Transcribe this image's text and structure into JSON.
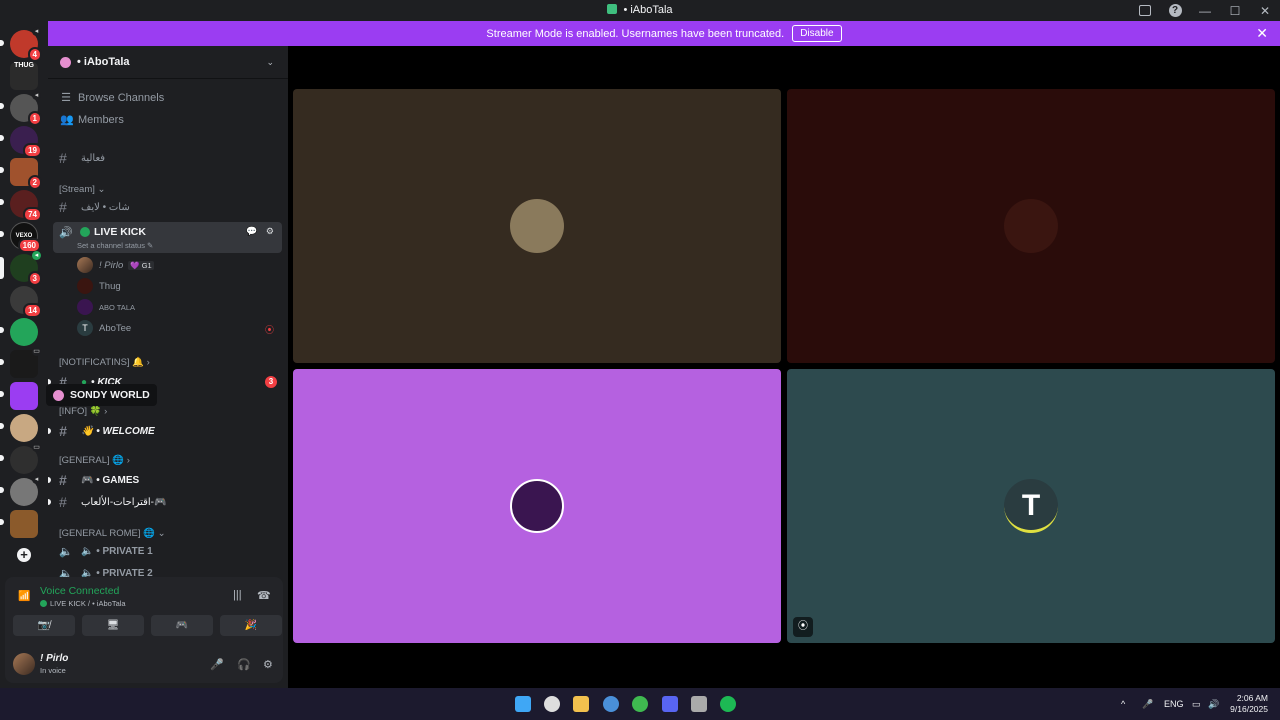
{
  "window": {
    "title": "• iAboTala",
    "inbox_icon": "inbox-icon",
    "help_icon": "help-icon",
    "help_glyph": "?",
    "minimize_glyph": "—",
    "maximize_glyph": "☐",
    "close_glyph": "✕"
  },
  "banner": {
    "text": "Streamer Mode is enabled. Usernames have been truncated.",
    "disable_label": "Disable",
    "close_glyph": "✕"
  },
  "rail": {
    "servers": [
      {
        "badge": "4",
        "color": "#c0392b"
      },
      {
        "label": "THUG",
        "color": "#2b2b2b"
      },
      {
        "badge": "1",
        "color": "#555555"
      },
      {
        "badge": "19",
        "color": "#3a1f4f"
      },
      {
        "badge": "2",
        "color": "#a0522d"
      },
      {
        "badge": "74",
        "color": "#5a1f1f"
      },
      {
        "badge": "160",
        "label": "VEXO",
        "color": "#111111"
      },
      {
        "badge": "3",
        "color": "#1f3f1f"
      },
      {
        "badge": "14",
        "color": "#3a3a3a"
      },
      {
        "color": "#23a55a"
      },
      {
        "color": "#1a1a1a"
      },
      {
        "color": "#9b3df2"
      },
      {
        "color": "#c8a882"
      },
      {
        "color": "#2f2f2f"
      },
      {
        "color": "#777777"
      },
      {
        "color": "#8b5a2b"
      }
    ],
    "add_glyph": "+",
    "tooltip": "SONDY WORLD"
  },
  "sidebar": {
    "guild_name": "• iAboTala",
    "chevron": "⌄",
    "browse_label": "Browse Channels",
    "members_label": "Members",
    "channels": {
      "fa3aliya": "فعالية",
      "stream_cat": "[Stream] ⌄",
      "chat_live": "شات • لايف",
      "live_kick": "LIVE KICK",
      "live_kick_status": "Set a channel status ✎",
      "live_kick_actions": "💬 ⚙",
      "notif_cat": "[NOTIFICATINS] 🔔 ›",
      "kick": "• KICK",
      "kick_mentions": "3",
      "info_cat": "[INFO] 🍀 ›",
      "welcome": "👋 • WELCOME",
      "general_cat": "[GENERAL] 🌐 ›",
      "games": "🎮 • GAMES",
      "suggestions": "اقتراحات-الألعاب-🎮",
      "general_rome_cat": "[GENERAL ROME] 🌐 ⌄",
      "private1": "🔈 • PRIVATE 1",
      "private2": "🔈 • PRIVATE 2"
    },
    "voice_users": [
      {
        "name": "! Pirlo",
        "tag": "💜 G1"
      },
      {
        "name": "Thug"
      },
      {
        "name": "ABO TALA"
      },
      {
        "name": "AboTee",
        "live": "⦿"
      }
    ]
  },
  "voice": {
    "title": "Voice Connected",
    "subtitle": "LIVE KICK / • iAboTala",
    "signal_glyph": "📶",
    "noise_glyph": "|||",
    "disconnect_glyph": "☎",
    "btn_camera": "📷̸",
    "btn_screen": "🖥",
    "btn_activity": "🎮",
    "btn_soundboard": "🎉"
  },
  "user": {
    "name": "! Pirlo",
    "status": "In voice",
    "mic_glyph": "🎤",
    "headset_glyph": "🎧",
    "settings_glyph": "⚙"
  },
  "tiles": [
    {
      "bg": "#352b20",
      "avatar": "#8a7a5c"
    },
    {
      "bg": "#2a0c0a",
      "avatar": "#3a1510"
    },
    {
      "bg": "#b561e0",
      "avatar": "#3a1550"
    },
    {
      "bg": "#2d4a4e",
      "avatar": "#2a3c40",
      "letter": "T"
    }
  ],
  "taskbar": {
    "lang": "ENG",
    "time": "2:06 AM",
    "date": "9/16/2025",
    "up_glyph": "^",
    "icons": [
      {
        "name": "start",
        "color": "#3fa7f5"
      },
      {
        "name": "search",
        "color": "#dddddd"
      },
      {
        "name": "explorer",
        "color": "#f2c14e"
      },
      {
        "name": "chrome",
        "color": "#4a90d9"
      },
      {
        "name": "xbox",
        "color": "#3fb950"
      },
      {
        "name": "discord",
        "color": "#5865f2"
      },
      {
        "name": "unity",
        "color": "#aaaaaa"
      },
      {
        "name": "spotify",
        "color": "#1db954"
      },
      {
        "name": "app",
        "color": "#3fbf7f"
      }
    ]
  }
}
